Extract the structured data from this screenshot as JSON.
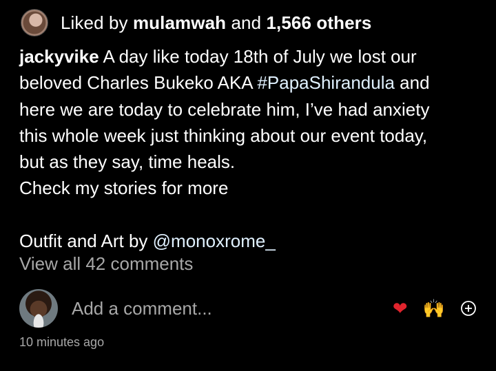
{
  "likes": {
    "prefix": "Liked by",
    "user": "mulamwah",
    "middle": "and",
    "count_text": "1,566 others"
  },
  "caption": {
    "username": "jackyvike",
    "line1": " A day like today 18th of July we lost our",
    "line2_pre": "beloved Charles Bukeko AKA ",
    "hashtag": "#PapaShirandula",
    "line2_post": " and",
    "line3": "here we are today to celebrate him, I’ve had anxiety",
    "line4": "this whole week just thinking about our event today,",
    "line5": "but as they say, time heals.",
    "line6": "Check my stories for more",
    "line8_pre": "Outfit and Art by ",
    "mention": "@monoxrome_"
  },
  "comments": {
    "view_all": "View all 42 comments"
  },
  "comment_bar": {
    "placeholder": "Add a comment...",
    "reactions": {
      "heart": "❤",
      "raised_hands": "🙌"
    },
    "add_icon": "plus-circle-icon"
  },
  "post_meta": {
    "timestamp": "10 minutes ago"
  },
  "colors": {
    "background": "#000000",
    "text": "#ffffff",
    "muted": "#a8a8a8",
    "heart": "#e0242d"
  }
}
